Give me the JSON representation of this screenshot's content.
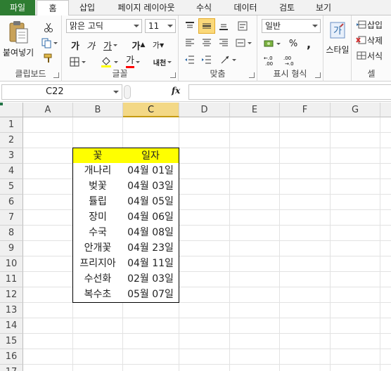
{
  "tabs": [
    {
      "label": "파일"
    },
    {
      "label": "홈"
    },
    {
      "label": "삽입"
    },
    {
      "label": "페이지 레이아웃"
    },
    {
      "label": "수식"
    },
    {
      "label": "데이터"
    },
    {
      "label": "검토"
    },
    {
      "label": "보기"
    }
  ],
  "ribbon": {
    "clipboard": {
      "label": "클립보드",
      "paste_label": "붙여넣기"
    },
    "font": {
      "label": "글꼴",
      "font_name": "맑은 고딕",
      "font_size": "11",
      "bold": "가",
      "italic": "가",
      "underline": "가",
      "grow": "가",
      "shrink": "가",
      "font_color": "가",
      "phonetic": "내천"
    },
    "alignment": {
      "label": "맞춤"
    },
    "number": {
      "label": "표시 형식",
      "format": "일반",
      "percent": "%",
      "comma": ","
    },
    "styles": {
      "label": "스타일"
    },
    "cells": {
      "label": "셀",
      "insert": "삽입",
      "delete": "삭제",
      "format": "서식"
    }
  },
  "formula_bar": {
    "name_box": "C22",
    "fx": "fx",
    "formula": ""
  },
  "columns": [
    "A",
    "B",
    "C",
    "D",
    "E",
    "F",
    "G"
  ],
  "rows": [
    "1",
    "2",
    "3",
    "4",
    "5",
    "6",
    "7",
    "8",
    "9",
    "10",
    "11",
    "12",
    "13",
    "14",
    "15",
    "16",
    "17"
  ],
  "table": {
    "headers": [
      "꽃",
      "일자"
    ],
    "rows": [
      [
        "개나리",
        "04월 01일"
      ],
      [
        "벚꽃",
        "04월 03일"
      ],
      [
        "튤립",
        "04월 05일"
      ],
      [
        "장미",
        "04월 06일"
      ],
      [
        "수국",
        "04월 08일"
      ],
      [
        "안개꽃",
        "04월 23일"
      ],
      [
        "프리지아",
        "04월 11일"
      ],
      [
        "수선화",
        "02월 03일"
      ],
      [
        "복수초",
        "05월 07일"
      ]
    ]
  },
  "colors": {
    "file_tab": "#2e7d32",
    "header_fill": "#ffff00",
    "selected_col": "#f3d886"
  }
}
